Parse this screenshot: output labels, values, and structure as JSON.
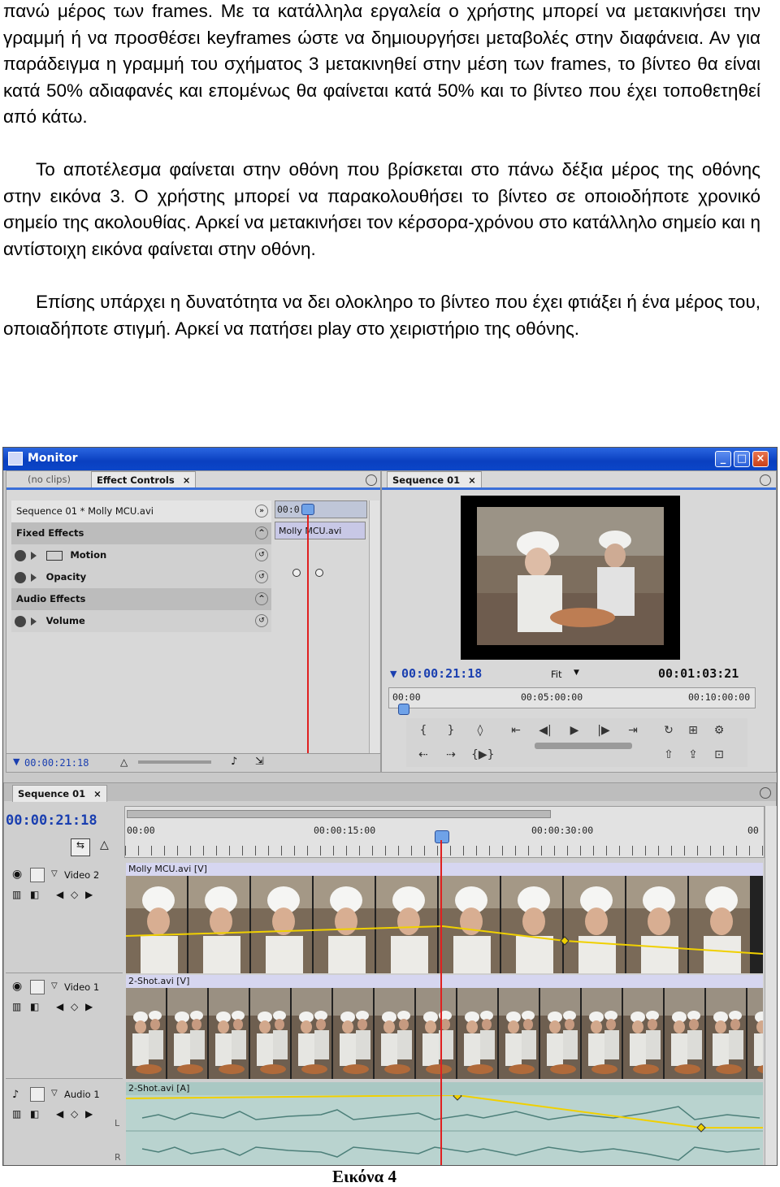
{
  "document": {
    "paragraphs": [
      "πανώ μέρος των frames. Με τα κατάλληλα εργαλεία ο χρήστης μπορεί να μετακινήσει την γραμμή ή να προσθέσει keyframes ώστε να δημιουργήσει μεταβολές στην διαφάνεια. Αν για παράδειγμα η γραμμή του σχήματος 3 μετακινηθεί στην μέση των frames, το βίντεο θα είναι κατά 50% αδιαφανές και επομένως θα φαίνεται κατά  50% και το βίντεο που έχει τοποθετηθεί από κάτω.",
      "Το αποτέλεσμα φαίνεται στην οθόνη που βρίσκεται στο πάνω δέξια μέρος της οθόνης στην εικόνα 3. Ο χρήστης μπορεί να παρακολουθήσει το βίντεο σε οποιοδήποτε χρονικό σημείο της ακολουθίας. Αρκεί να μετακινήσει τον κέρσορα-χρόνου στο κατάλληλο σημείο και η αντίστοιχη εικόνα φαίνεται στην οθόνη.",
      "Επίσης υπάρχει η δυνατότητα να δει ολοκληρο το βίντεο που έχει φτιάξει ή ένα μέρος του, οποιαδήποτε στιγμή. Αρκεί να πατήσει play στο χειριστήριο της οθόνης."
    ],
    "caption": "Εικόνα 4"
  },
  "screenshot": {
    "window_title": "Monitor",
    "source_panel": {
      "tab_inactive": "(no clips)",
      "tab_active": "Effect Controls",
      "sequence_label": "Sequence 01 * Molly MCU.avi",
      "timeline_timecode": "00:0",
      "clip_name": "Molly MCU.avi",
      "fixed_effects": "Fixed Effects",
      "motion": "Motion",
      "opacity": "Opacity",
      "audio_effects": "Audio Effects",
      "volume": "Volume",
      "footer_timecode": "00:00:21:18"
    },
    "program_panel": {
      "tab": "Sequence 01",
      "current_tc": "00:00:21:18",
      "fit": "Fit",
      "duration_tc": "00:01:03:21",
      "ruler": [
        "00:00",
        "00:05:00:00",
        "00:10:00:00"
      ]
    },
    "timeline": {
      "tab": "Sequence 01",
      "current_tc": "00:00:21:18",
      "ruler": [
        "00:00",
        "00:00:15:00",
        "00:00:30:00",
        "00"
      ],
      "tracks": [
        {
          "name": "Video 2",
          "clip": "Molly MCU.avi [V]"
        },
        {
          "name": "Video 1",
          "clip": "2-Shot.avi [V]"
        },
        {
          "name": "Audio 1",
          "clip": "2-Shot.avi [A]"
        }
      ],
      "channels": [
        "L",
        "R"
      ]
    },
    "icons": [
      "monitor-app-icon",
      "minimize-icon",
      "maximize-icon",
      "close-icon",
      "eye-icon",
      "play-icon",
      "step-back-icon",
      "step-forward-icon",
      "lock-icon",
      "speaker-icon"
    ]
  }
}
